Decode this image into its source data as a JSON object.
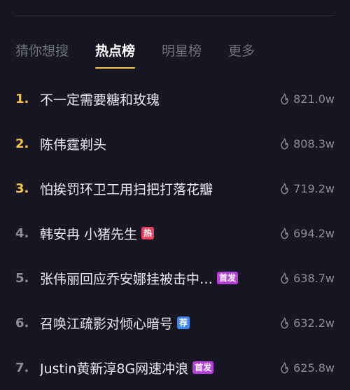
{
  "tabs": [
    {
      "label": "猜你想搜",
      "active": false
    },
    {
      "label": "热点榜",
      "active": true
    },
    {
      "label": "明星榜",
      "active": false
    },
    {
      "label": "更多",
      "active": false
    }
  ],
  "items": [
    {
      "rank": "1.",
      "title": "不一定需要糖和玫瑰",
      "heat": "821.0w",
      "badge": null,
      "badge_color": null
    },
    {
      "rank": "2.",
      "title": "陈伟霆剃头",
      "heat": "808.3w",
      "badge": null,
      "badge_color": null
    },
    {
      "rank": "3.",
      "title": "怕挨罚环卫工用扫把打落花瓣",
      "heat": "719.2w",
      "badge": null,
      "badge_color": null
    },
    {
      "rank": "4.",
      "title": "韩安冉 小猪先生",
      "heat": "694.2w",
      "badge": "热",
      "badge_color": "#e8415e"
    },
    {
      "rank": "5.",
      "title": "张伟丽回应乔安娜挂被击中…",
      "heat": "638.7w",
      "badge": "首发",
      "badge_color": "#b541d8"
    },
    {
      "rank": "6.",
      "title": "召唤江疏影对倾心暗号",
      "heat": "632.2w",
      "badge": "荐",
      "badge_color": "#3c86f0"
    },
    {
      "rank": "7.",
      "title": "Justin黄新淳8G网速冲浪",
      "heat": "625.8w",
      "badge": "首发",
      "badge_color": "#b541d8"
    }
  ],
  "colors": {
    "background": "#161722",
    "top_rank": "#f6c443",
    "tab_indicator": "#f2c94c"
  },
  "icons": {
    "heat": "flame-icon"
  }
}
